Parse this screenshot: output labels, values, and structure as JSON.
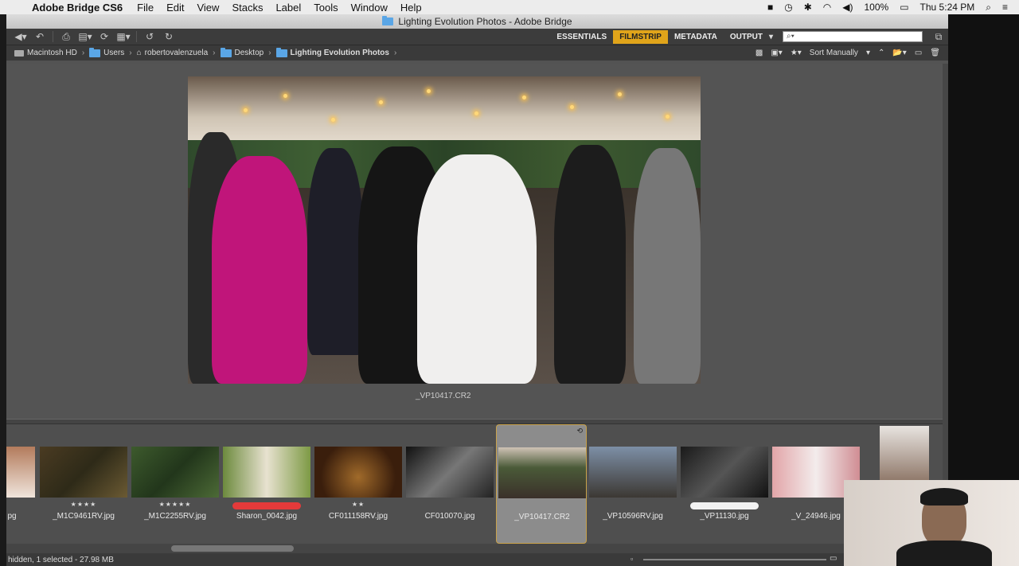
{
  "menubar": {
    "app_name": "Adobe Bridge CS6",
    "menus": [
      "File",
      "Edit",
      "View",
      "Stacks",
      "Label",
      "Tools",
      "Window",
      "Help"
    ],
    "battery": "100%",
    "clock": "Thu 5:24 PM"
  },
  "window": {
    "title": "Lighting Evolution Photos - Adobe Bridge"
  },
  "workspaces": {
    "items": [
      "ESSENTIALS",
      "FILMSTRIP",
      "METADATA",
      "OUTPUT"
    ],
    "active": "FILMSTRIP",
    "accent_color": "#e0a41a"
  },
  "search": {
    "placeholder": "",
    "icon": "search-icon"
  },
  "path": {
    "crumbs": [
      "Macintosh HD",
      "Users",
      "robertovalenzuela",
      "Desktop",
      "Lighting Evolution Photos"
    ]
  },
  "sort": {
    "label": "Sort Manually"
  },
  "preview": {
    "filename": "_VP10417.CR2"
  },
  "filmstrip": {
    "items": [
      {
        "name": "pg",
        "stars": "",
        "label_color": ""
      },
      {
        "name": "_M1C9461RV.jpg",
        "stars": "★★★★",
        "label_color": ""
      },
      {
        "name": "_M1C2255RV.jpg",
        "stars": "★★★★★",
        "label_color": ""
      },
      {
        "name": "Sharon_0042.jpg",
        "stars": "",
        "label_color": "#e43a3a"
      },
      {
        "name": "CF011158RV.jpg",
        "stars": "★★",
        "label_color": ""
      },
      {
        "name": "CF010070.jpg",
        "stars": "",
        "label_color": ""
      },
      {
        "name": "_VP10417.CR2",
        "stars": "",
        "label_color": ""
      },
      {
        "name": "_VP10596RV.jpg",
        "stars": "",
        "label_color": ""
      },
      {
        "name": "_VP11130.jpg",
        "stars": "",
        "label_color": "#f2f2f2"
      },
      {
        "name": "_V_24946.jpg",
        "stars": "",
        "label_color": ""
      }
    ],
    "selected_index": 6
  },
  "status": {
    "text": "hidden, 1 selected - 27.98 MB"
  }
}
